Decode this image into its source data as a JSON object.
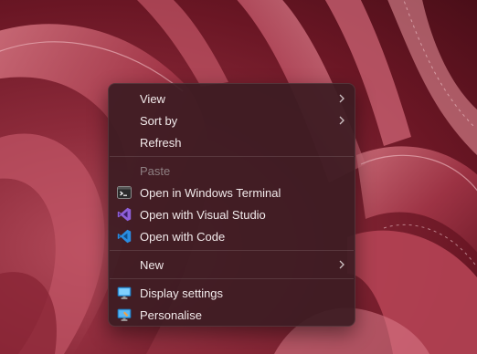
{
  "context_menu": {
    "items": [
      {
        "label": "View",
        "has_submenu": true
      },
      {
        "label": "Sort by",
        "has_submenu": true
      },
      {
        "label": "Refresh"
      },
      {
        "label": "Paste",
        "disabled": true
      },
      {
        "label": "Open in Windows Terminal",
        "icon": "terminal-icon"
      },
      {
        "label": "Open with Visual Studio",
        "icon": "visual-studio-icon"
      },
      {
        "label": "Open with Code",
        "icon": "vscode-icon"
      },
      {
        "label": "New",
        "has_submenu": true
      },
      {
        "label": "Display settings",
        "icon": "display-icon"
      },
      {
        "label": "Personalise",
        "icon": "personalise-icon"
      }
    ]
  },
  "colors": {
    "menu_background": "#3c1c22",
    "text": "#f2eaeb",
    "disabled_text": "#8e7f82",
    "wallpaper": "#8c2a3a"
  }
}
